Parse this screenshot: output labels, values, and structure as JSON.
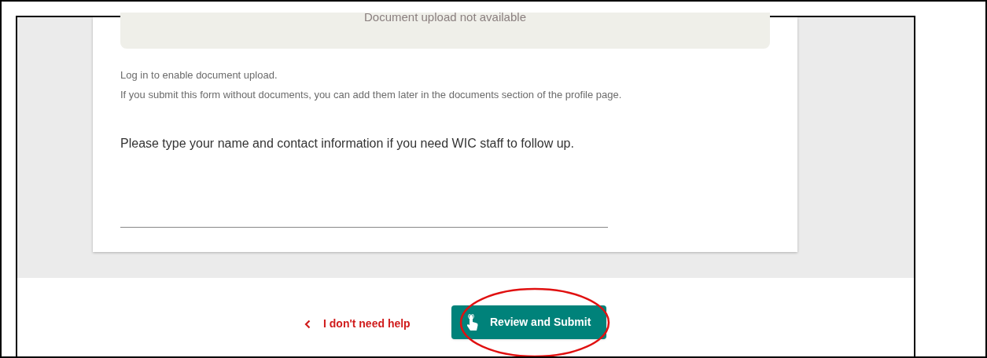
{
  "upload_box": {
    "text": "Document upload not available"
  },
  "notes": [
    "Log in to enable document upload.",
    "If you submit this form without documents, you can add them later in the documents section of the profile page."
  ],
  "question": "Please type your name and contact information if you need WIC staff to follow up.",
  "footer": {
    "back_link": "I don't need help",
    "submit_button": "Review and Submit"
  }
}
